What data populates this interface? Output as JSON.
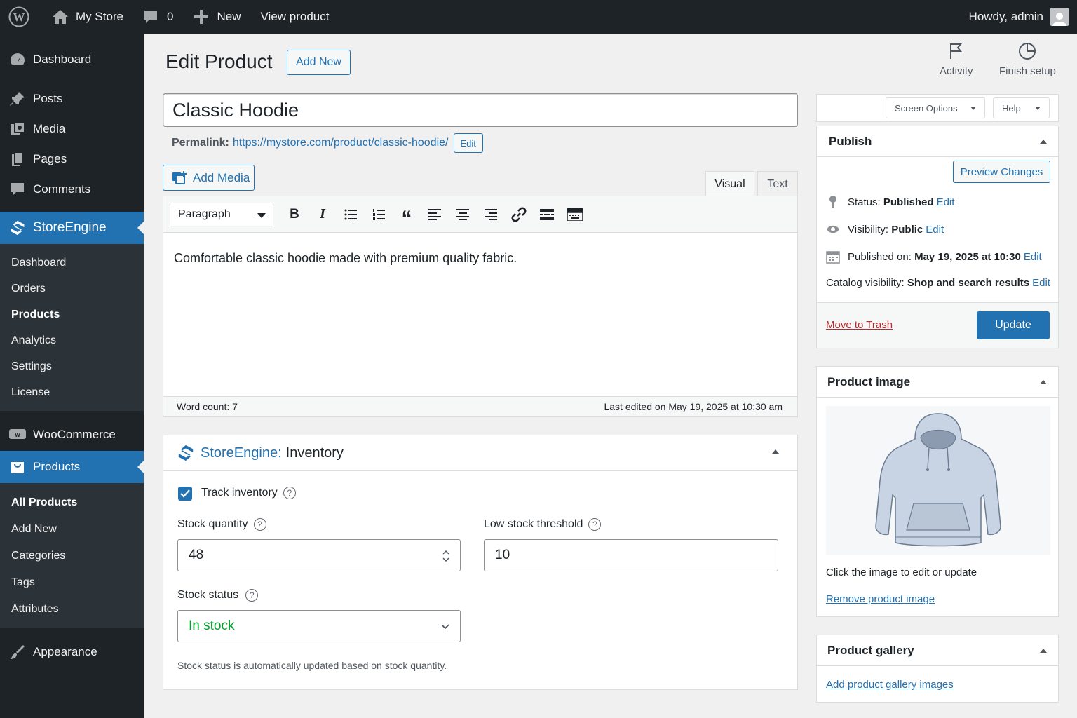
{
  "adminbar": {
    "site_name": "My Store",
    "comments_count": "0",
    "new_label": "New",
    "view_label": "View product",
    "howdy": "Howdy, admin"
  },
  "sidebar": {
    "dashboard": "Dashboard",
    "posts": "Posts",
    "media": "Media",
    "pages": "Pages",
    "comments": "Comments",
    "storeengine": "StoreEngine",
    "se_sub": [
      "Dashboard",
      "Orders",
      "Products",
      "Analytics",
      "Settings",
      "License"
    ],
    "woocommerce": "WooCommerce",
    "products": "Products",
    "prod_sub": [
      "All Products",
      "Add New",
      "Categories",
      "Tags",
      "Attributes"
    ],
    "appearance": "Appearance"
  },
  "header": {
    "title": "Edit Product",
    "add_new": "Add New",
    "activity": "Activity",
    "finish_setup": "Finish setup",
    "screen_options": "Screen Options",
    "help": "Help"
  },
  "product": {
    "title": "Classic Hoodie",
    "permalink_label": "Permalink:",
    "permalink_url": "https://mystore.com/product/classic-hoodie/",
    "permalink_edit": "Edit"
  },
  "editor": {
    "add_media": "Add Media",
    "tab_visual": "Visual",
    "tab_text": "Text",
    "format": "Paragraph",
    "content": "Comfortable classic hoodie made with premium quality fabric.",
    "word_count": "Word count: 7",
    "last_edited": "Last edited on May 19, 2025 at 10:30 am"
  },
  "inventory": {
    "brand": "StoreEngine:",
    "title": "Inventory",
    "track_label": "Track inventory",
    "track_checked": true,
    "stock_qty_label": "Stock quantity",
    "stock_qty_value": "48",
    "low_stock_label": "Low stock threshold",
    "low_stock_value": "10",
    "stock_status_label": "Stock status",
    "stock_status_value": "In stock",
    "stock_status_color": "#00a32a",
    "hint": "Stock status is automatically updated based on stock quantity."
  },
  "publish": {
    "title": "Publish",
    "preview": "Preview Changes",
    "status_label": "Status:",
    "status_value": "Published",
    "visibility_label": "Visibility:",
    "visibility_value": "Public",
    "published_label": "Published on:",
    "published_value": "May 19, 2025 at 10:30",
    "catalog_label": "Catalog visibility:",
    "catalog_value": "Shop and search results",
    "edit": "Edit",
    "trash": "Move to Trash",
    "update": "Update"
  },
  "product_image": {
    "title": "Product image",
    "hint": "Click the image to edit or update",
    "remove": "Remove product image"
  },
  "gallery": {
    "title": "Product gallery",
    "add": "Add product gallery images"
  },
  "colors": {
    "accent": "#2271b1",
    "adminbar": "#1d2327",
    "trash": "#b32d2e"
  }
}
